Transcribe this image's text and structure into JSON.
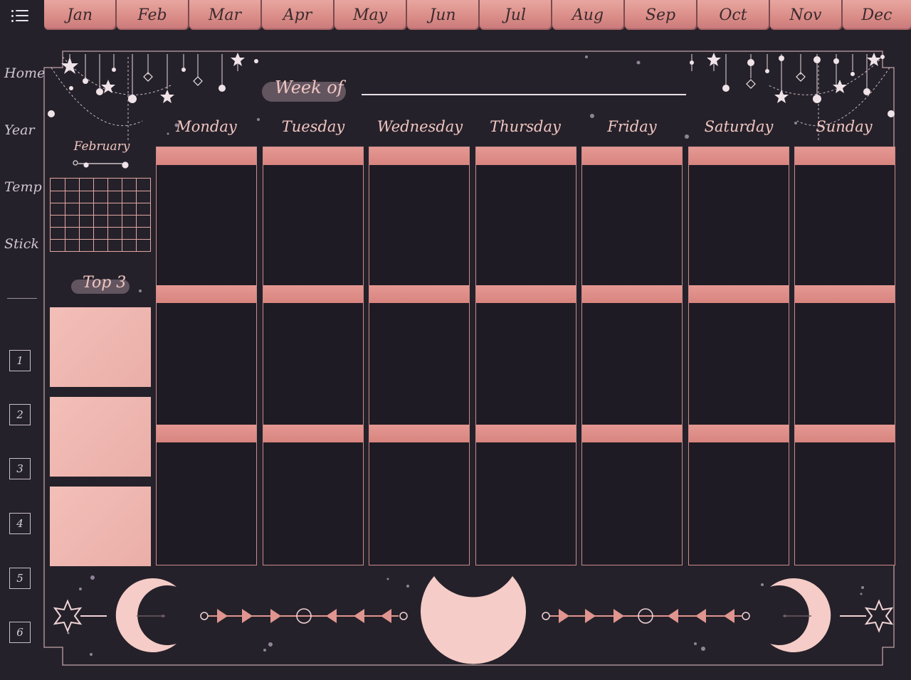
{
  "menu": {
    "icon": "hamburger-menu-icon"
  },
  "months": [
    "Jan",
    "Feb",
    "Mar",
    "Apr",
    "May",
    "Jun",
    "Jul",
    "Aug",
    "Sep",
    "Oct",
    "Nov",
    "Dec"
  ],
  "sidebar": {
    "links": [
      "Home",
      "Year",
      "Temp",
      "Stick"
    ],
    "numbers": [
      "1",
      "2",
      "3",
      "4",
      "5",
      "6"
    ]
  },
  "header": {
    "week_label": "Week of"
  },
  "mini_calendar": {
    "month": "February"
  },
  "top3": {
    "label": "Top 3"
  },
  "days": [
    "Monday",
    "Tuesday",
    "Wednesday",
    "Thursday",
    "Friday",
    "Saturday",
    "Sunday"
  ],
  "colors": {
    "background": "#25212a",
    "accent": "#e0958f",
    "accent_light": "#f3bfb8",
    "text": "#f0c6c1"
  }
}
